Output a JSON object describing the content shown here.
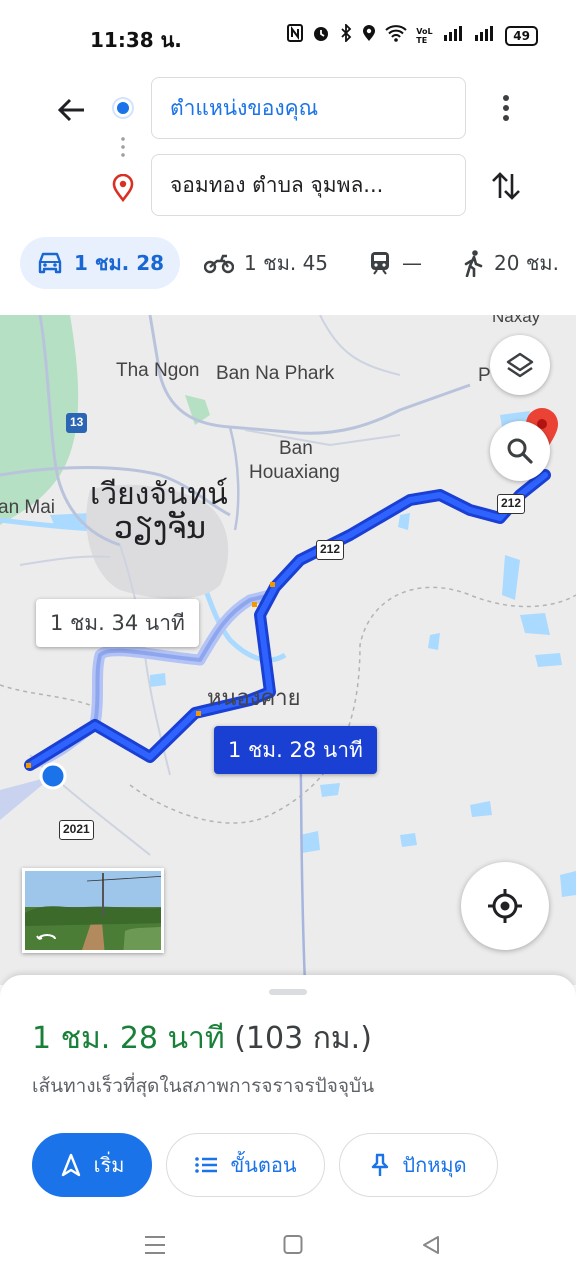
{
  "status": {
    "time": "11:38 น.",
    "battery": "49",
    "network_text": "VoLTE"
  },
  "route": {
    "origin": "ตำแหน่งของคุณ",
    "destination": "จอมทอง ตำบล จุมพล..."
  },
  "modes": [
    {
      "name": "car",
      "label": "1 ชม. 28",
      "active": true
    },
    {
      "name": "motorcycle",
      "label": "1 ชม. 45",
      "active": false
    },
    {
      "name": "transit",
      "label": "—",
      "active": false
    },
    {
      "name": "walk",
      "label": "20 ชม.",
      "active": false
    }
  ],
  "map": {
    "labels": {
      "naxay": "Naxay",
      "tha_ngon": "Tha Ngon",
      "ban_na_phark": "Ban Na Phark",
      "ban": "Ban",
      "houaxiang": "Houaxiang",
      "vientiane_line1": "เวียงจันทน์",
      "vientiane_line2": "ວຽງຈັນ",
      "an_mai": "an Mai",
      "nong_khai": "หนองคาย",
      "p": "P"
    },
    "shields": {
      "r13": "13",
      "r212a": "212",
      "r212b": "212",
      "r2021": "2021"
    },
    "alt_route_label": "1 ชม. 34 นาที",
    "main_route_label": "1 ชม. 28 นาที"
  },
  "summary": {
    "time": "1 ชม. 28 นาที",
    "distance": "(103 กม.)",
    "description": "เส้นทางเร็วที่สุดในสภาพการจราจรปัจจุบัน"
  },
  "actions": {
    "start": "เริ่ม",
    "steps": "ขั้นตอน",
    "pin": "ปักหมุด"
  },
  "colors": {
    "accent": "#1a73e8",
    "route": "#1a3fd3",
    "duration_green": "#188038"
  }
}
